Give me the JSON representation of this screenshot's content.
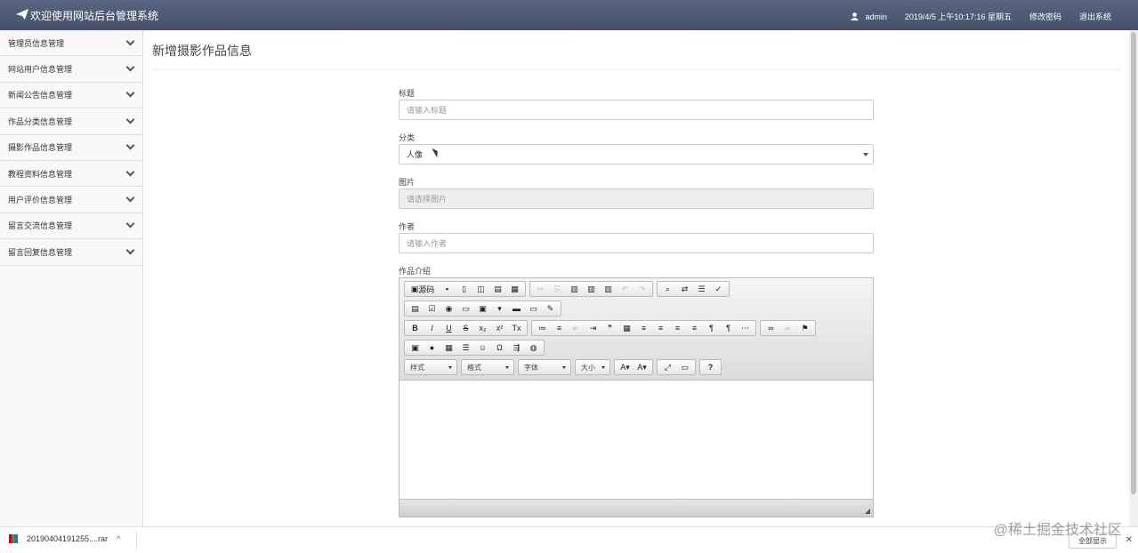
{
  "header": {
    "title": "欢迎使用网站后台管理系统",
    "user": "admin",
    "datetime": "2019/4/5 上午10:17:16 星期五",
    "change_password": "修改密码",
    "logout": "退出系统"
  },
  "sidebar": {
    "items": [
      {
        "label": "管理员信息管理"
      },
      {
        "label": "网站用户信息管理"
      },
      {
        "label": "新闻公告信息管理"
      },
      {
        "label": "作品分类信息管理"
      },
      {
        "label": "摄影作品信息管理"
      },
      {
        "label": "教程资料信息管理"
      },
      {
        "label": "用户评价信息管理"
      },
      {
        "label": "留言交流信息管理"
      },
      {
        "label": "留言回复信息管理"
      }
    ]
  },
  "main": {
    "page_title": "新增摄影作品信息",
    "form": {
      "title_label": "标题",
      "title_placeholder": "请输入标题",
      "category_label": "分类",
      "category_value": "人像",
      "image_label": "图片",
      "image_placeholder": "请选择图片",
      "author_label": "作者",
      "author_placeholder": "请输入作者",
      "intro_label": "作品介绍"
    },
    "editor": {
      "source_label": "源码",
      "combo_style": "样式",
      "combo_format": "格式",
      "combo_font": "字体",
      "combo_size": "大小",
      "help": "?"
    }
  },
  "downloads": {
    "file_name": "20190404191255....rar",
    "show_all": "全部显示"
  },
  "watermark": "@稀土掘金技术社区"
}
